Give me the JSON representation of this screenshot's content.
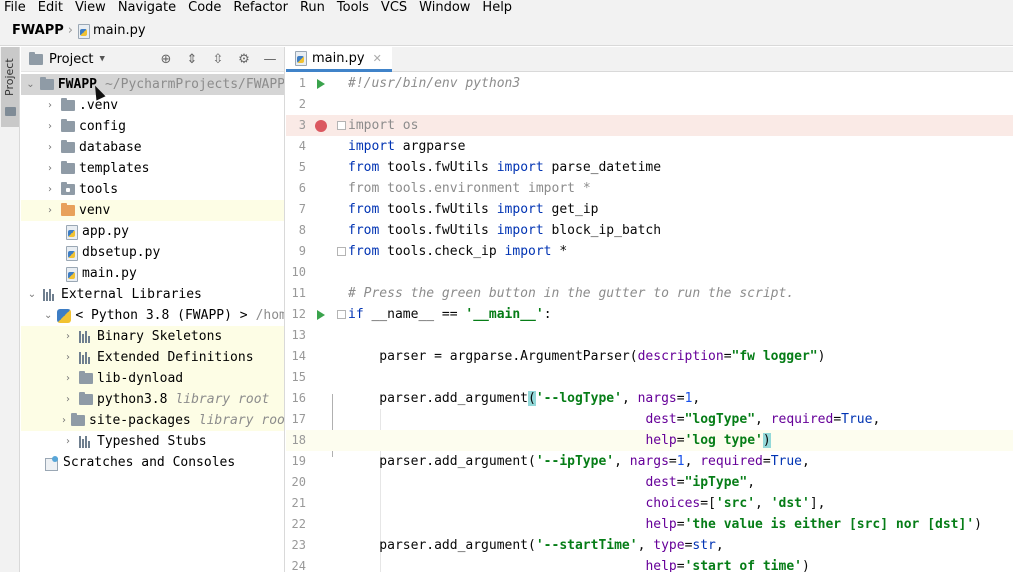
{
  "menu": [
    {
      "label": "File"
    },
    {
      "label": "Edit"
    },
    {
      "label": "View"
    },
    {
      "label": "Navigate"
    },
    {
      "label": "Code"
    },
    {
      "label": "Refactor"
    },
    {
      "label": "Run"
    },
    {
      "label": "Tools"
    },
    {
      "label": "VCS"
    },
    {
      "label": "Window"
    },
    {
      "label": "Help"
    }
  ],
  "breadcrumb": {
    "project": "FWAPP",
    "file": "main.py"
  },
  "toolstrip": {
    "project_tab": "Project"
  },
  "project_pane": {
    "title": "Project",
    "tree": [
      {
        "label": "FWAPP",
        "extra": "~/PycharmProjects/FWAPP"
      },
      {
        "label": ".venv"
      },
      {
        "label": "config"
      },
      {
        "label": "database"
      },
      {
        "label": "templates"
      },
      {
        "label": "tools"
      },
      {
        "label": "venv"
      },
      {
        "label": "app.py"
      },
      {
        "label": "dbsetup.py"
      },
      {
        "label": "main.py"
      },
      {
        "label": "External Libraries"
      },
      {
        "label": "< Python 3.8 (FWAPP) >",
        "extra": "/home"
      },
      {
        "label": "Binary Skeletons"
      },
      {
        "label": "Extended Definitions"
      },
      {
        "label": "lib-dynload"
      },
      {
        "label": "python3.8",
        "extra": "library root"
      },
      {
        "label": "site-packages",
        "extra": "library root"
      },
      {
        "label": "Typeshed Stubs"
      },
      {
        "label": "Scratches and Consoles"
      }
    ]
  },
  "editor": {
    "tab_label": "main.py",
    "line_numbers": [
      "1",
      "2",
      "3",
      "4",
      "5",
      "6",
      "7",
      "8",
      "9",
      "10",
      "11",
      "12",
      "13",
      "14",
      "15",
      "16",
      "17",
      "18",
      "19",
      "20",
      "21",
      "22",
      "23",
      "24"
    ],
    "tokens": {
      "l1": "#!/usr/bin/env python3",
      "import": "import",
      "from": "from",
      "os": " os",
      "argparse": " argparse",
      "fwutils": " tools.fwUtils ",
      "parse_datetime": " parse_datetime",
      "l6_from": "from",
      "l6_mod": " tools.environment ",
      "l6_import": "import",
      "l6_star": " *",
      "get_ip": " get_ip",
      "block_ip_batch": " block_ip_batch",
      "check_ip": " tools.check_ip ",
      "star": " *",
      "l11": "# Press the green button in the gutter to run the script.",
      "if": "if",
      "dunder_name": " __name__ == ",
      "main_str": "'__main__'",
      "colon": ":",
      "l14_a": "    parser = argparse.ArgumentParser(",
      "description": "description",
      "eq": "=",
      "fw_logger": "\"fw logger\"",
      "rparen": ")",
      "add_arg": "    parser.add_argument",
      "lparen": "(",
      "logType_flag": "'--logType'",
      "comma_sp": ", ",
      "nargs": "nargs",
      "one": "1",
      "comma": ",",
      "cont_indent": "                   ",
      "dest": "dest",
      "logType_dest": "\"logType\"",
      "required": "required",
      "true": "True",
      "help": "help",
      "log_type_help": "'log type'",
      "ipType_flag": "'--ipType'",
      "ipType_dest": "\"ipType\"",
      "choices": "choices",
      "choices_val_a": "[",
      "src": "'src'",
      "dst": "'dst'",
      "choices_val_b": "]",
      "ip_help": "'the value is either [src] nor [dst]'",
      "startTime_flag": "'--startTime'",
      "type": "type",
      "str": "str",
      "start_help": "'start of time'"
    }
  },
  "colors": {
    "keyword": "#0033b3",
    "string": "#067d17",
    "param": "#660099",
    "number": "#1750eb",
    "comment": "#8c8c8c",
    "breakpoint": "#db5860",
    "run": "#3aa34c"
  }
}
